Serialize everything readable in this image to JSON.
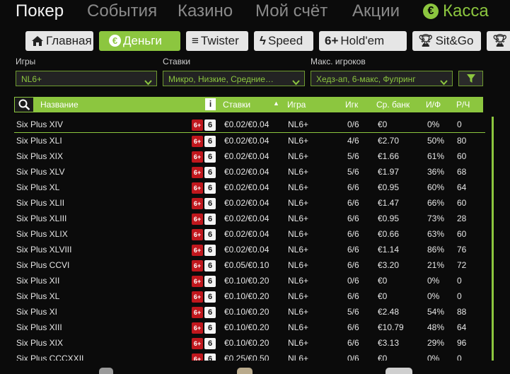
{
  "top_nav": {
    "items": [
      "Покер",
      "События",
      "Казино",
      "Мой счёт",
      "Акции"
    ],
    "cashier": "Касса"
  },
  "tabs": [
    {
      "label": "Главная",
      "icon": "home-icon"
    },
    {
      "label": "Деньги",
      "icon": "euro-icon",
      "active": true
    },
    {
      "label": "Twister",
      "icon": "twister-icon"
    },
    {
      "label": "Speed",
      "icon": "lightning-icon"
    },
    {
      "label": "Hold'em",
      "icon": "six-plus-icon",
      "prefix": "6+"
    },
    {
      "label": "Sit&Go",
      "icon": "trophy-icon"
    }
  ],
  "filters": {
    "games": {
      "label": "Игры",
      "value": "NL6+"
    },
    "stakes": {
      "label": "Ставки",
      "value": "Микро, Низкие, Средние…"
    },
    "max_players": {
      "label": "Макс. игроков",
      "value": "Хедз-ап, 6-макс, Фулринг"
    }
  },
  "table": {
    "columns": {
      "name": "Название",
      "stakes": "Ставки",
      "game": "Игра",
      "players": "Игк",
      "avg_pot": "Ср. банк",
      "flop": "И/Ф",
      "hands": "Р/Ч"
    },
    "badge_6plus": "6+",
    "badge_6": "6",
    "rows": [
      {
        "name": "Six Plus XIV",
        "stakes": "€0.02/€0.04",
        "game": "NL6+",
        "players": "0/6",
        "avg_pot": "€0",
        "flop": "0%",
        "hands": "0"
      },
      {
        "name": "Six Plus XLI",
        "stakes": "€0.02/€0.04",
        "game": "NL6+",
        "players": "4/6",
        "avg_pot": "€2.70",
        "flop": "50%",
        "hands": "80"
      },
      {
        "name": "Six Plus XIX",
        "stakes": "€0.02/€0.04",
        "game": "NL6+",
        "players": "5/6",
        "avg_pot": "€1.66",
        "flop": "61%",
        "hands": "60"
      },
      {
        "name": "Six Plus XLV",
        "stakes": "€0.02/€0.04",
        "game": "NL6+",
        "players": "5/6",
        "avg_pot": "€1.97",
        "flop": "36%",
        "hands": "68"
      },
      {
        "name": "Six Plus XL",
        "stakes": "€0.02/€0.04",
        "game": "NL6+",
        "players": "6/6",
        "avg_pot": "€0.95",
        "flop": "60%",
        "hands": "64"
      },
      {
        "name": "Six Plus XLII",
        "stakes": "€0.02/€0.04",
        "game": "NL6+",
        "players": "6/6",
        "avg_pot": "€1.47",
        "flop": "66%",
        "hands": "60"
      },
      {
        "name": "Six Plus XLIII",
        "stakes": "€0.02/€0.04",
        "game": "NL6+",
        "players": "6/6",
        "avg_pot": "€0.95",
        "flop": "73%",
        "hands": "28"
      },
      {
        "name": "Six Plus XLIX",
        "stakes": "€0.02/€0.04",
        "game": "NL6+",
        "players": "6/6",
        "avg_pot": "€0.66",
        "flop": "63%",
        "hands": "60"
      },
      {
        "name": "Six Plus XLVIII",
        "stakes": "€0.02/€0.04",
        "game": "NL6+",
        "players": "6/6",
        "avg_pot": "€1.14",
        "flop": "86%",
        "hands": "76"
      },
      {
        "name": "Six Plus CCVI",
        "stakes": "€0.05/€0.10",
        "game": "NL6+",
        "players": "6/6",
        "avg_pot": "€3.20",
        "flop": "21%",
        "hands": "72"
      },
      {
        "name": "Six Plus XII",
        "stakes": "€0.10/€0.20",
        "game": "NL6+",
        "players": "0/6",
        "avg_pot": "€0",
        "flop": "0%",
        "hands": "0"
      },
      {
        "name": "Six Plus XL",
        "stakes": "€0.10/€0.20",
        "game": "NL6+",
        "players": "6/6",
        "avg_pot": "€0",
        "flop": "0%",
        "hands": "0"
      },
      {
        "name": "Six Plus XI",
        "stakes": "€0.10/€0.20",
        "game": "NL6+",
        "players": "5/6",
        "avg_pot": "€2.48",
        "flop": "54%",
        "hands": "88"
      },
      {
        "name": "Six Plus XIII",
        "stakes": "€0.10/€0.20",
        "game": "NL6+",
        "players": "6/6",
        "avg_pot": "€10.79",
        "flop": "48%",
        "hands": "64"
      },
      {
        "name": "Six Plus XIX",
        "stakes": "€0.10/€0.20",
        "game": "NL6+",
        "players": "6/6",
        "avg_pot": "€3.13",
        "flop": "29%",
        "hands": "96"
      },
      {
        "name": "Six Plus CCCXXII",
        "stakes": "€0.25/€0.50",
        "game": "NL6+",
        "players": "0/6",
        "avg_pot": "€0",
        "flop": "0%",
        "hands": "0"
      }
    ]
  },
  "colors": {
    "accent": "#8cc63f",
    "badge_red": "#c0171d",
    "background": "#0b0b0b"
  }
}
